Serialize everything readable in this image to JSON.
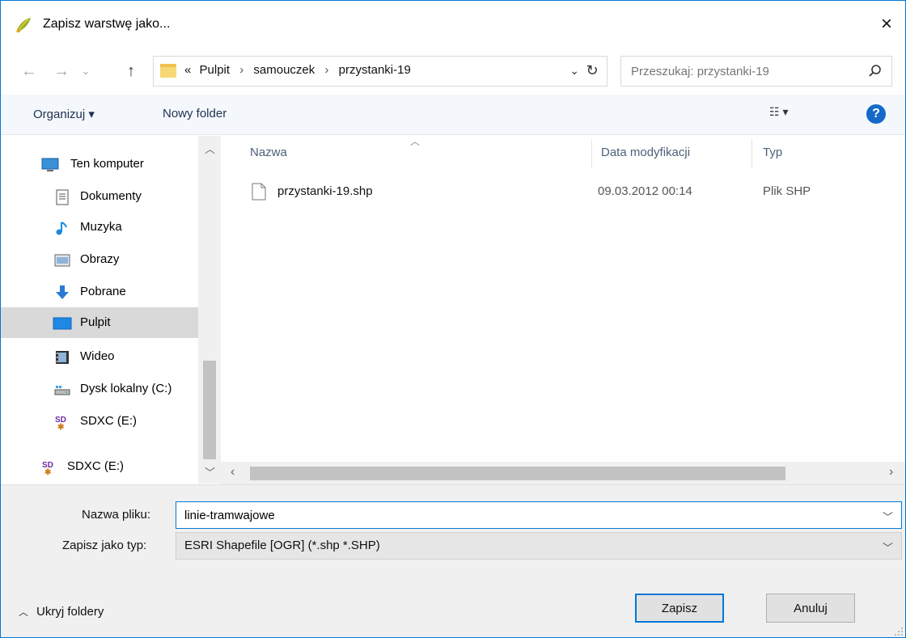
{
  "window": {
    "title": "Zapisz warstwę jako...",
    "close_icon": "×",
    "accent": "#0078d7"
  },
  "nav": {
    "back_icon": "←",
    "forward_icon": "→",
    "recent_icon": "⌄",
    "up_icon": "↑",
    "breadcrumb_prefix": "«",
    "breadcrumb": [
      "Pulpit",
      "samouczek",
      "przystanki-19"
    ],
    "search_placeholder": "Przeszukaj: przystanki-19"
  },
  "toolbar": {
    "organize_label": "Organizuj ▾",
    "new_folder_label": "Nowy folder",
    "view_icon": "☷ ▾",
    "help_label": "?"
  },
  "sidebar": {
    "items": [
      {
        "label": "Ten komputer",
        "icon": "computer-icon"
      },
      {
        "label": "Dokumenty",
        "icon": "documents-icon"
      },
      {
        "label": "Muzyka",
        "icon": "music-icon"
      },
      {
        "label": "Obrazy",
        "icon": "pictures-icon"
      },
      {
        "label": "Pobrane",
        "icon": "downloads-icon"
      },
      {
        "label": "Pulpit",
        "icon": "desktop-icon",
        "selected": true
      },
      {
        "label": "Wideo",
        "icon": "video-icon"
      },
      {
        "label": "Dysk lokalny (C:)",
        "icon": "drive-icon"
      },
      {
        "label": "SDXC (E:)",
        "icon": "sd-card-icon"
      },
      {
        "label": "SDXC (E:)",
        "icon": "sd-card-icon"
      }
    ]
  },
  "files": {
    "columns": [
      "Nazwa",
      "Data modyfikacji",
      "Typ"
    ],
    "rows": [
      {
        "name": "przystanki-19.shp",
        "modified": "09.03.2012 00:14",
        "type": "Plik SHP"
      }
    ]
  },
  "form": {
    "filename_label": "Nazwa pliku:",
    "filename_value": "linie-tramwajowe",
    "type_label": "Zapisz jako typ:",
    "type_value": "ESRI Shapefile [OGR] (*.shp *.SHP)"
  },
  "footer": {
    "hide_folders_label": "Ukryj foldery",
    "save_label": "Zapisz",
    "cancel_label": "Anuluj"
  }
}
